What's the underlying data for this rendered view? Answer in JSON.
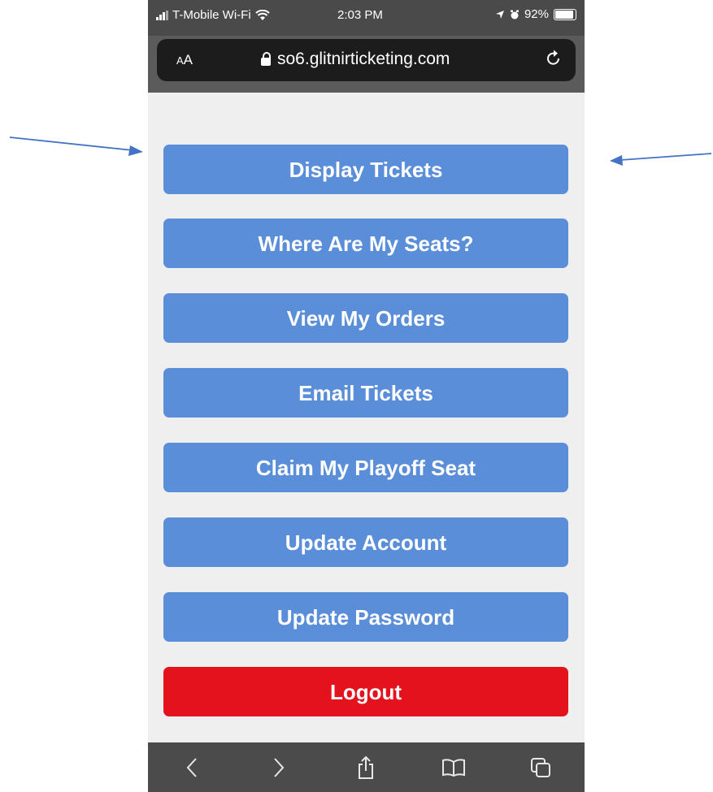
{
  "status_bar": {
    "carrier": "T-Mobile Wi-Fi",
    "time": "2:03 PM",
    "battery": "92%"
  },
  "url_bar": {
    "reader_label_small": "A",
    "reader_label_large": "A",
    "url": "so6.glitnirticketing.com"
  },
  "menu": {
    "items": [
      {
        "label": "Display Tickets"
      },
      {
        "label": "Where Are My Seats?"
      },
      {
        "label": "View My Orders"
      },
      {
        "label": "Email Tickets"
      },
      {
        "label": "Claim My Playoff Seat"
      },
      {
        "label": "Update Account"
      },
      {
        "label": "Update Password"
      }
    ],
    "logout_label": "Logout"
  },
  "toolbar": {
    "icons": [
      "back-icon",
      "forward-icon",
      "share-icon",
      "bookmarks-icon",
      "tabs-icon"
    ]
  },
  "colors": {
    "button": "#5b8ed9",
    "logout": "#e3121c",
    "annotation_arrow": "#4472c4"
  }
}
